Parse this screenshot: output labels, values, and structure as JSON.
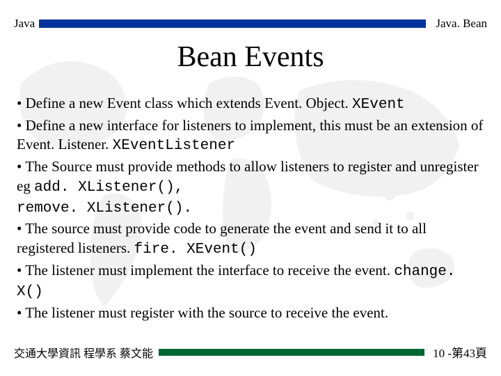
{
  "header": {
    "left": "Java",
    "right": "Java. Bean"
  },
  "title": "Bean Events",
  "bullets": {
    "b1a": "• Define a new Event class which extends Event. Object. ",
    "b1code": "XEvent",
    "b2a": "• Define a new interface for listeners to implement, this must be an extension of Event. Listener. ",
    "b2code": "XEventListener",
    "b3a": "• The Source must provide methods to allow listeners to register and unregister eg ",
    "b3code1": "add. XListener(),",
    "b3code2": "remove. XListener().",
    "b4a": "• The source must provide code to generate the event and send it to all registered listeners. ",
    "b4code": "fire. XEvent()",
    "b5a": "• The listener must implement the interface to receive the event. ",
    "b5code": "change. X()",
    "b6": "• The listener must register with the source to receive the event."
  },
  "footer": {
    "left": "交通大學資訊 程學系 蔡文能",
    "right": "10 -第43頁"
  },
  "colors": {
    "headerBar": "#003399",
    "footerBar": "#006633"
  }
}
